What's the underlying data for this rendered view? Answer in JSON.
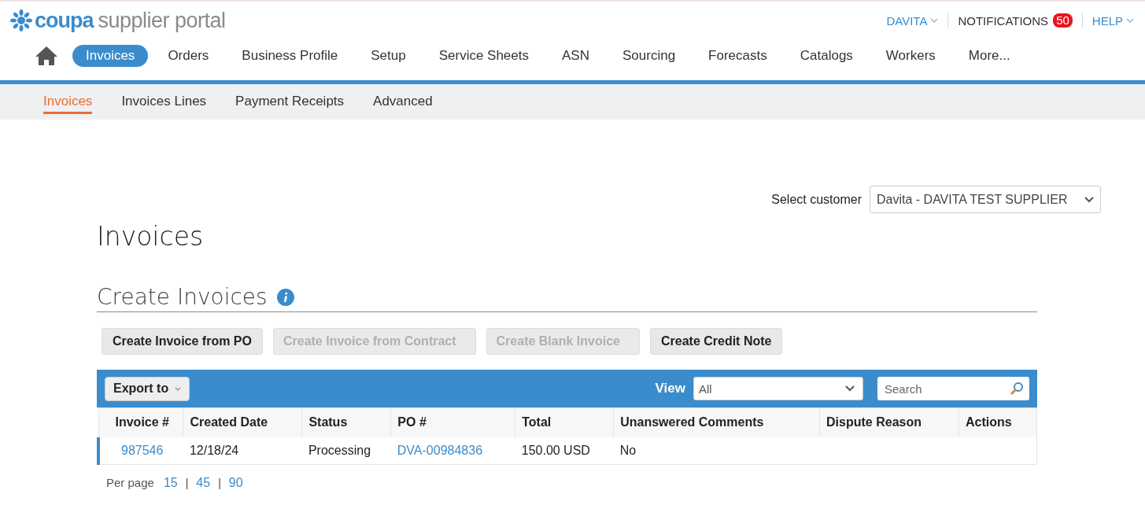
{
  "header": {
    "logo": {
      "brand": "coupa",
      "product": "supplier portal"
    },
    "top_links": [
      {
        "kind": "menu",
        "label": "DAVITA"
      },
      {
        "kind": "badge",
        "label": "NOTIFICATIONS",
        "count": "50"
      },
      {
        "kind": "menu",
        "label": "HELP"
      }
    ]
  },
  "nav": [
    {
      "label": "Invoices",
      "selected": true
    },
    {
      "label": "Orders",
      "selected": false
    },
    {
      "label": "Business Profile",
      "selected": false
    },
    {
      "label": "Setup",
      "selected": false
    },
    {
      "label": "Service Sheets",
      "selected": false
    },
    {
      "label": "ASN",
      "selected": false
    },
    {
      "label": "Sourcing",
      "selected": false
    },
    {
      "label": "Forecasts",
      "selected": false
    },
    {
      "label": "Catalogs",
      "selected": false
    },
    {
      "label": "Workers",
      "selected": false
    },
    {
      "label": "More...",
      "selected": false
    }
  ],
  "subnav": [
    {
      "label": "Invoices",
      "selected": true
    },
    {
      "label": "Invoices Lines",
      "selected": false
    },
    {
      "label": "Payment Receipts",
      "selected": false
    },
    {
      "label": "Advanced",
      "selected": false
    }
  ],
  "customer": {
    "label": "Select customer",
    "value": "Davita - DAVITA TEST SUPPLIER"
  },
  "page_title": "Invoices",
  "section_title": "Create Invoices",
  "buttons": [
    {
      "label": "Create Invoice from PO",
      "disabled": false
    },
    {
      "label": "Create Invoice from Contract",
      "disabled": true
    },
    {
      "label": "Create Blank Invoice",
      "disabled": true
    },
    {
      "label": "Create Credit Note",
      "disabled": false
    }
  ],
  "toolbar": {
    "export": "Export to",
    "view_label": "View",
    "view_value": "All",
    "search_placeholder": "Search"
  },
  "table": {
    "columns": [
      "Invoice #",
      "Created Date",
      "Status",
      "PO #",
      "Total",
      "Unanswered Comments",
      "Dispute Reason",
      "Actions"
    ],
    "rows": [
      {
        "cells": [
          {
            "text": "987546",
            "kind": "link"
          },
          {
            "text": "12/18/24",
            "kind": "text"
          },
          {
            "text": "Processing",
            "kind": "text"
          },
          {
            "text": "DVA-00984836",
            "kind": "link"
          },
          {
            "text": "150.00 USD",
            "kind": "text"
          },
          {
            "text": "No",
            "kind": "text"
          }
        ]
      }
    ]
  },
  "pagination": {
    "label": "Per page",
    "separator": "|",
    "options": [
      "15",
      "45",
      "90"
    ]
  }
}
